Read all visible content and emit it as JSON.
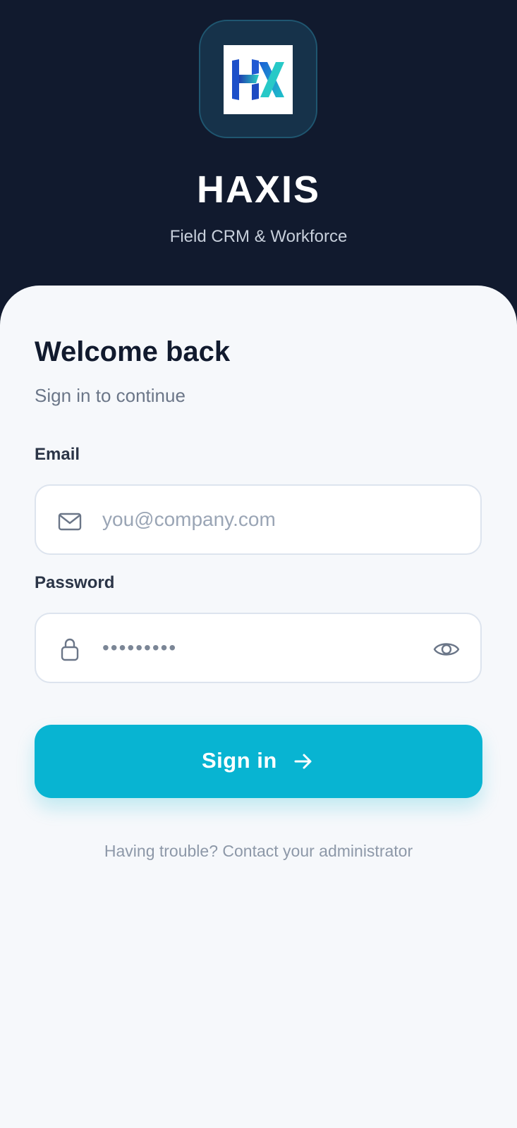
{
  "header": {
    "app_name": "HAXIS",
    "tagline": "Field CRM & Workforce",
    "logo_icon": "haxis-hx-logo",
    "logo_text": "HX"
  },
  "login": {
    "title": "Welcome back",
    "subtitle": "Sign in to continue",
    "email": {
      "label": "Email",
      "placeholder": "you@company.com",
      "value": "",
      "icon": "mail-icon"
    },
    "password": {
      "label": "Password",
      "value": "•••••••••",
      "icon": "lock-icon",
      "toggle_icon": "eye-icon"
    },
    "submit_label": "Sign in",
    "submit_icon": "arrow-right-icon",
    "help_text": "Having trouble? Contact your administrator"
  },
  "colors": {
    "header_bg": "#111a2e",
    "card_bg": "#f6f8fb",
    "accent": "#08b4d2",
    "logo_tile": "#16324a"
  }
}
